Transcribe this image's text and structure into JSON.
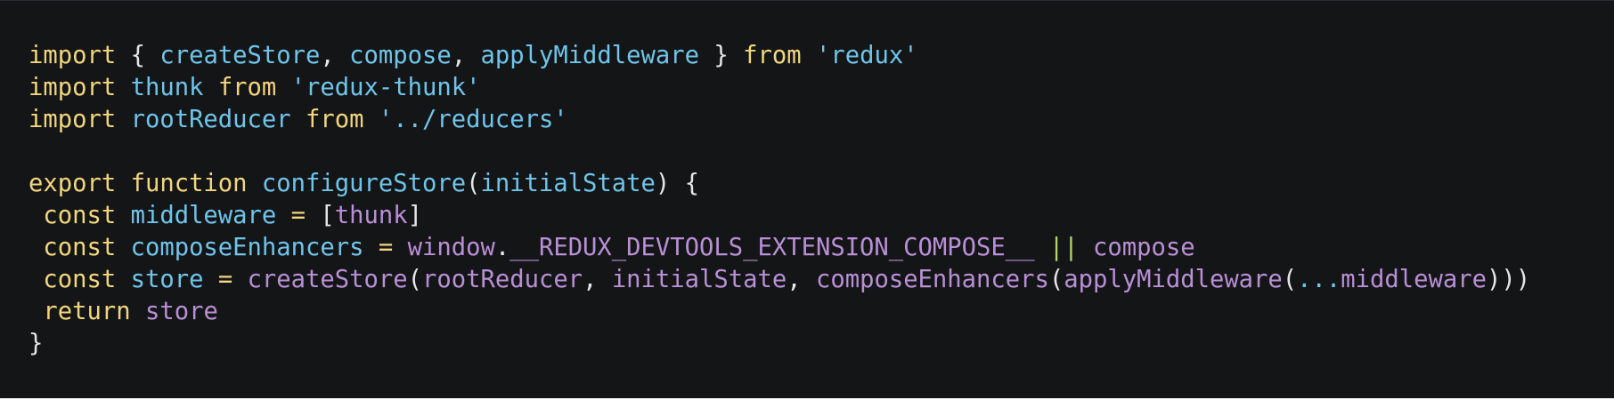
{
  "code": {
    "lines": [
      [
        {
          "t": "import",
          "c": "kw"
        },
        {
          "t": " ",
          "c": "punc"
        },
        {
          "t": "{",
          "c": "punc"
        },
        {
          "t": " ",
          "c": "punc"
        },
        {
          "t": "createStore",
          "c": "id"
        },
        {
          "t": ",",
          "c": "punc"
        },
        {
          "t": " ",
          "c": "punc"
        },
        {
          "t": "compose",
          "c": "id"
        },
        {
          "t": ",",
          "c": "punc"
        },
        {
          "t": " ",
          "c": "punc"
        },
        {
          "t": "applyMiddleware",
          "c": "id"
        },
        {
          "t": " ",
          "c": "punc"
        },
        {
          "t": "}",
          "c": "punc"
        },
        {
          "t": " ",
          "c": "punc"
        },
        {
          "t": "from",
          "c": "kw"
        },
        {
          "t": " ",
          "c": "punc"
        },
        {
          "t": "'redux'",
          "c": "str"
        }
      ],
      [
        {
          "t": "import",
          "c": "kw"
        },
        {
          "t": " ",
          "c": "punc"
        },
        {
          "t": "thunk",
          "c": "id"
        },
        {
          "t": " ",
          "c": "punc"
        },
        {
          "t": "from",
          "c": "kw"
        },
        {
          "t": " ",
          "c": "punc"
        },
        {
          "t": "'redux-thunk'",
          "c": "str"
        }
      ],
      [
        {
          "t": "import",
          "c": "kw"
        },
        {
          "t": " ",
          "c": "punc"
        },
        {
          "t": "rootReducer",
          "c": "id"
        },
        {
          "t": " ",
          "c": "punc"
        },
        {
          "t": "from",
          "c": "kw"
        },
        {
          "t": " ",
          "c": "punc"
        },
        {
          "t": "'../reducers'",
          "c": "str"
        }
      ],
      [],
      [
        {
          "t": "export",
          "c": "kw"
        },
        {
          "t": " ",
          "c": "punc"
        },
        {
          "t": "function",
          "c": "kw"
        },
        {
          "t": " ",
          "c": "punc"
        },
        {
          "t": "configureStore",
          "c": "id"
        },
        {
          "t": "(",
          "c": "punc"
        },
        {
          "t": "initialState",
          "c": "id"
        },
        {
          "t": ")",
          "c": "punc"
        },
        {
          "t": " ",
          "c": "punc"
        },
        {
          "t": "{",
          "c": "punc"
        }
      ],
      [
        {
          "t": " ",
          "c": "punc"
        },
        {
          "t": "const",
          "c": "kw"
        },
        {
          "t": " ",
          "c": "punc"
        },
        {
          "t": "middleware",
          "c": "id"
        },
        {
          "t": " ",
          "c": "punc"
        },
        {
          "t": "=",
          "c": "kw"
        },
        {
          "t": " ",
          "c": "punc"
        },
        {
          "t": "[",
          "c": "punc"
        },
        {
          "t": "thunk",
          "c": "var"
        },
        {
          "t": "]",
          "c": "punc"
        }
      ],
      [
        {
          "t": " ",
          "c": "punc"
        },
        {
          "t": "const",
          "c": "kw"
        },
        {
          "t": " ",
          "c": "punc"
        },
        {
          "t": "composeEnhancers",
          "c": "id"
        },
        {
          "t": " ",
          "c": "punc"
        },
        {
          "t": "=",
          "c": "kw"
        },
        {
          "t": " ",
          "c": "punc"
        },
        {
          "t": "window",
          "c": "var"
        },
        {
          "t": ".",
          "c": "punc"
        },
        {
          "t": "__REDUX_DEVTOOLS_EXTENSION_COMPOSE__",
          "c": "var"
        },
        {
          "t": " ",
          "c": "punc"
        },
        {
          "t": "||",
          "c": "op"
        },
        {
          "t": " ",
          "c": "punc"
        },
        {
          "t": "compose",
          "c": "var"
        }
      ],
      [
        {
          "t": " ",
          "c": "punc"
        },
        {
          "t": "const",
          "c": "kw"
        },
        {
          "t": " ",
          "c": "punc"
        },
        {
          "t": "store",
          "c": "id"
        },
        {
          "t": " ",
          "c": "punc"
        },
        {
          "t": "=",
          "c": "kw"
        },
        {
          "t": " ",
          "c": "punc"
        },
        {
          "t": "createStore",
          "c": "var"
        },
        {
          "t": "(",
          "c": "punc"
        },
        {
          "t": "rootReducer",
          "c": "var"
        },
        {
          "t": ",",
          "c": "punc"
        },
        {
          "t": " ",
          "c": "punc"
        },
        {
          "t": "initialState",
          "c": "var"
        },
        {
          "t": ",",
          "c": "punc"
        },
        {
          "t": " ",
          "c": "punc"
        },
        {
          "t": "composeEnhancers",
          "c": "var"
        },
        {
          "t": "(",
          "c": "punc"
        },
        {
          "t": "applyMiddleware",
          "c": "var"
        },
        {
          "t": "(",
          "c": "punc"
        },
        {
          "t": "...",
          "c": "id"
        },
        {
          "t": "middleware",
          "c": "var"
        },
        {
          "t": ")))",
          "c": "punc"
        }
      ],
      [
        {
          "t": " ",
          "c": "punc"
        },
        {
          "t": "return",
          "c": "kw"
        },
        {
          "t": " ",
          "c": "punc"
        },
        {
          "t": "store",
          "c": "var"
        }
      ],
      [
        {
          "t": "}",
          "c": "punc"
        }
      ]
    ]
  }
}
